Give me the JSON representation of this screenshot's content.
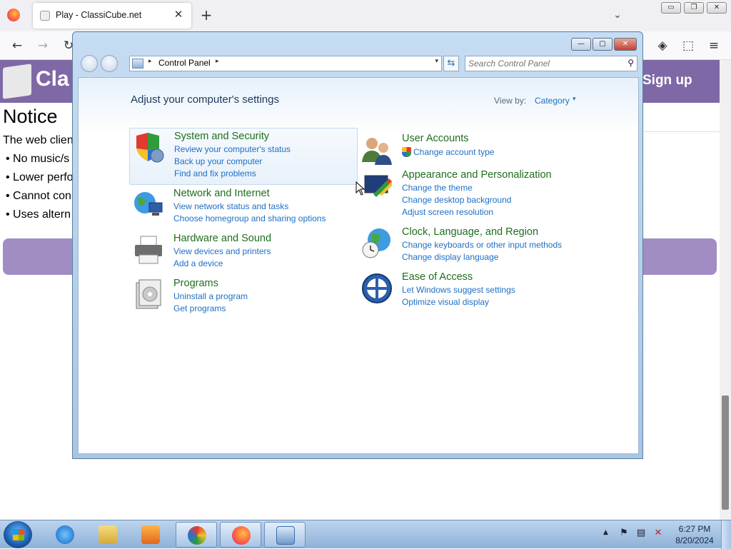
{
  "browser": {
    "tab_title": "Play - ClassiCube.net",
    "tab_close": "✕",
    "new_tab": "+",
    "list_tabs": "⌄",
    "window_buttons": [
      "▭",
      "❐",
      "✕"
    ],
    "nav": {
      "back": "←",
      "forward": "→",
      "reload": "↻",
      "pocket": "◈",
      "extensions": "⬚",
      "menu": "≡"
    }
  },
  "website": {
    "site_name": "Cla",
    "signup": "Sign up",
    "notice_heading": "Notice",
    "notice_text": "The web clien",
    "bullets": [
      "• No music/s",
      "• Lower perfo",
      "• Cannot con",
      "• Uses altern"
    ]
  },
  "control_panel": {
    "window_buttons": {
      "minimize": "—",
      "maximize": "▢",
      "close": "✕"
    },
    "address": {
      "root_arrow": "▸",
      "location": "Control Panel",
      "sep_arrow": "▸",
      "dropdown": "▾",
      "refresh": "⇆"
    },
    "search": {
      "placeholder": "Search Control Panel",
      "icon": "⚲"
    },
    "heading": "Adjust your computer's settings",
    "view_by": {
      "label": "View by:",
      "value": "Category",
      "arrow": "▾"
    },
    "categories": [
      {
        "title": "System and Security",
        "icon": "shield-icon",
        "links": [
          "Review your computer's status",
          "Back up your computer",
          "Find and fix problems"
        ]
      },
      {
        "title": "Network and Internet",
        "icon": "network-globe-icon",
        "links": [
          "View network status and tasks",
          "Choose homegroup and sharing options"
        ]
      },
      {
        "title": "Hardware and Sound",
        "icon": "printer-icon",
        "links": [
          "View devices and printers",
          "Add a device"
        ]
      },
      {
        "title": "Programs",
        "icon": "programs-icon",
        "links": [
          "Uninstall a program",
          "Get programs"
        ]
      },
      {
        "title": "User Accounts",
        "icon": "users-icon",
        "links": [
          "Change account type"
        ]
      },
      {
        "title": "Appearance and Personalization",
        "icon": "monitor-paint-icon",
        "links": [
          "Change the theme",
          "Change desktop background",
          "Adjust screen resolution"
        ]
      },
      {
        "title": "Clock, Language, and Region",
        "icon": "clock-globe-icon",
        "links": [
          "Change keyboards or other input methods",
          "Change display language"
        ]
      },
      {
        "title": "Ease of Access",
        "icon": "ease-of-access-icon",
        "links": [
          "Let Windows suggest settings",
          "Optimize visual display"
        ]
      }
    ]
  },
  "taskbar": {
    "tray_arrow": "▲",
    "time": "6:27 PM",
    "date": "8/20/2024",
    "colors": {
      "accent": "#8eb1d8"
    }
  }
}
